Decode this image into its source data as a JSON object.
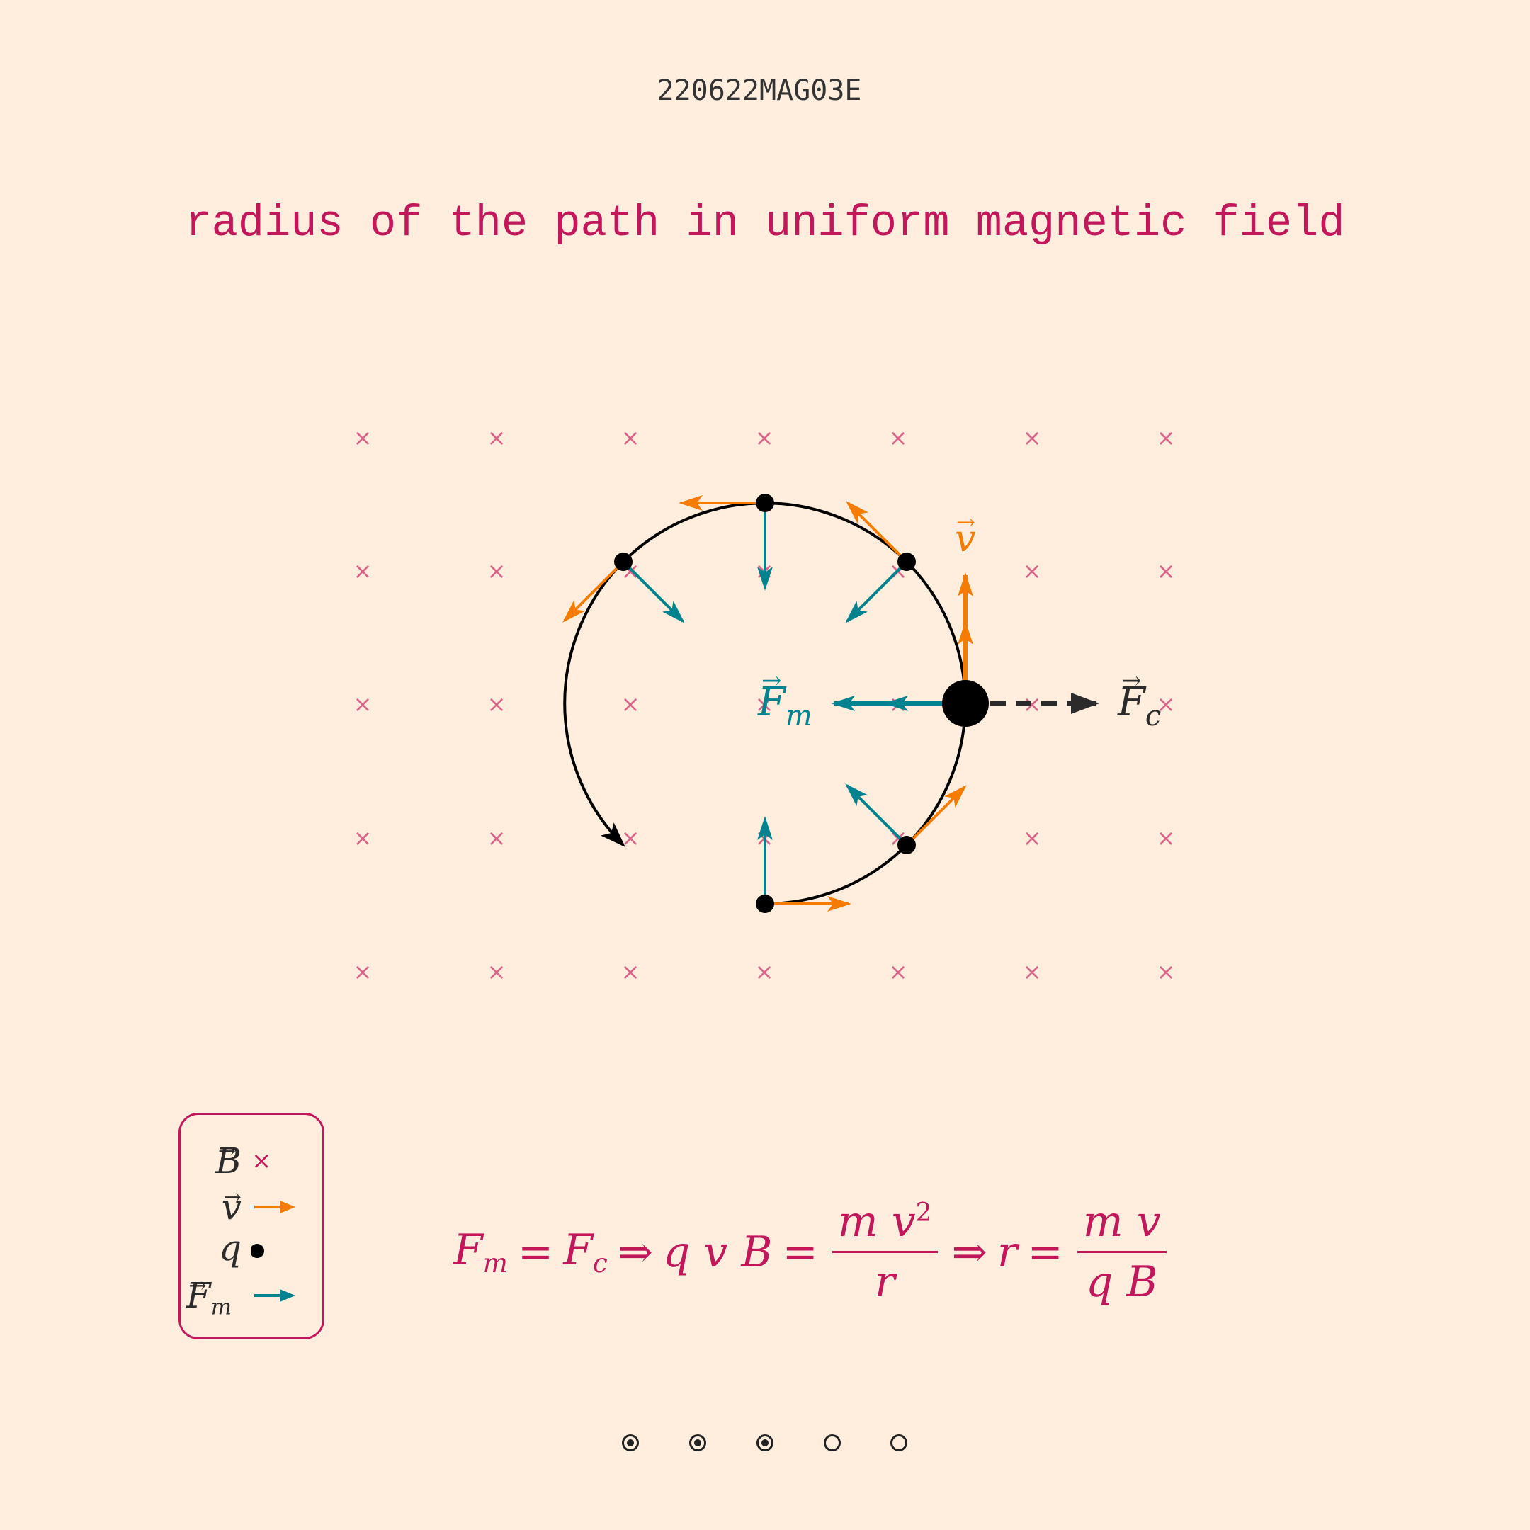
{
  "header": {
    "code": "220622MAG03E",
    "title": "radius of the path in uniform magnetic field"
  },
  "colors": {
    "background": "#FFEEDD",
    "accent": "#C2185B",
    "velocity": "#F57C00",
    "magnetic_force": "#00838F",
    "path": "#000000",
    "field_marks": "#D9658A"
  },
  "diagram": {
    "field_mark_glyph": "×",
    "labels": {
      "velocity": "v",
      "magnetic_force": "F",
      "magnetic_force_sub": "m",
      "centripetal_force": "F",
      "centripetal_force_sub": "c"
    }
  },
  "legend": {
    "field_symbol": "B",
    "field_mark": "×",
    "velocity_symbol": "v",
    "charge_symbol": "q",
    "force_symbol": "F",
    "force_sub": "m"
  },
  "formula": {
    "lhs_sym": "F",
    "lhs_sub": "m",
    "eq1": "=",
    "rhs_sym": "F",
    "rhs_sub": "c",
    "implies1": "⇒",
    "qvB": "q v B",
    "eq2": "=",
    "frac1_num": "m v",
    "frac1_sup": "2",
    "frac1_den": "r",
    "implies2": "⇒",
    "r": "r",
    "eq3": "=",
    "frac2_num": "m v",
    "frac2_den": "q B"
  },
  "pagination": {
    "total": 5,
    "filled": [
      true,
      true,
      true,
      false,
      false
    ]
  }
}
